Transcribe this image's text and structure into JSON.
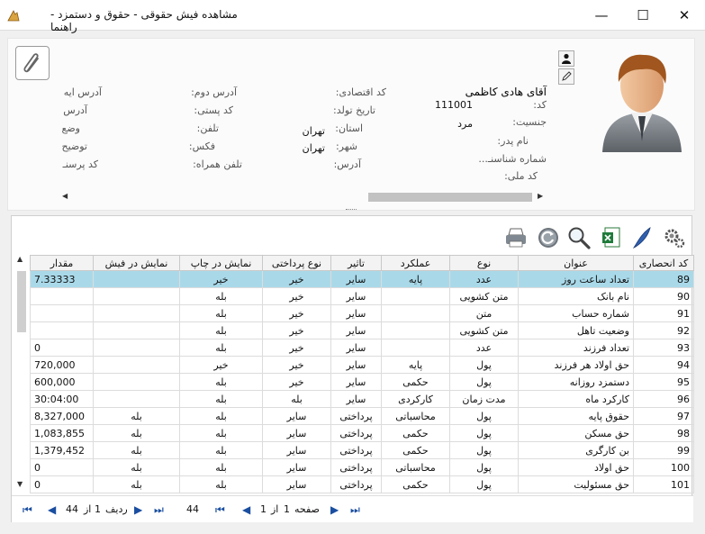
{
  "window": {
    "title": "مشاهده فیش حقوقی - حقوق و دستمزد - راهنما",
    "minimize_glyph": "—",
    "maximize_glyph": "☐",
    "close_glyph": "✕"
  },
  "employee": {
    "name": "آقای هادی کاظمی",
    "code_label": "کد:",
    "code_value": "111001",
    "gender_label": "جنسیت:",
    "gender_value": "مرد",
    "father_label": "نام پدر:",
    "id_number_label": "شماره شناسنـ...",
    "national_code_label": "کد ملی:",
    "economic_code_label": "کد اقتصادی:",
    "birth_date_label": "تاریخ تولد:",
    "province_label": "استان:",
    "province_value": "تهران",
    "city_label": "شهر:",
    "city_value": "تهران",
    "address_label": "آدرس:",
    "address2_label": "آدرس دوم:",
    "postal_code_label": "کد پستی:",
    "phone_label": "تلفن:",
    "fax_label": "فکس:",
    "mobile_label": "تلفن همراه:",
    "col4_address_label": "آدرس ایه",
    "col4_address_label2": "آدرس",
    "col4_status_label": "وضع",
    "col4_desc_label": "توضیح",
    "col4_personnel_code_label": "کد پرسنـ"
  },
  "grid": {
    "columns": [
      "کد انحصاری",
      "عنوان",
      "نوع",
      "عملکرد",
      "تاثیر",
      "نوع پرداختی",
      "نمایش در چاپ",
      "نمایش در فیش",
      "مقدار"
    ],
    "rows": [
      {
        "code": "89",
        "title": "تعداد ساعت روز",
        "type": "عدد",
        "perf": "پایه",
        "effect": "سایر",
        "pay": "خیر",
        "print": "خیر",
        "show": "",
        "amount": "7.33333",
        "selected": true
      },
      {
        "code": "90",
        "title": "نام بانک",
        "type": "متن کشویی",
        "perf": "",
        "effect": "سایر",
        "pay": "خیر",
        "print": "بله",
        "show": "",
        "amount": "",
        "selected": false
      },
      {
        "code": "91",
        "title": "شماره حساب",
        "type": "متن",
        "perf": "",
        "effect": "سایر",
        "pay": "خیر",
        "print": "بله",
        "show": "",
        "amount": "",
        "selected": false
      },
      {
        "code": "92",
        "title": "وضعیت تاهل",
        "type": "متن کشویی",
        "perf": "",
        "effect": "سایر",
        "pay": "خیر",
        "print": "بله",
        "show": "",
        "amount": "",
        "selected": false
      },
      {
        "code": "93",
        "title": "تعداد فرزند",
        "type": "عدد",
        "perf": "",
        "effect": "سایر",
        "pay": "خیر",
        "print": "بله",
        "show": "",
        "amount": "0",
        "selected": false
      },
      {
        "code": "94",
        "title": "حق اولاد هر فرزند",
        "type": "پول",
        "perf": "پایه",
        "effect": "سایر",
        "pay": "خیر",
        "print": "خیر",
        "show": "",
        "amount": "720,000",
        "selected": false
      },
      {
        "code": "95",
        "title": "دستمزد روزانه",
        "type": "پول",
        "perf": "حکمی",
        "effect": "سایر",
        "pay": "خیر",
        "print": "بله",
        "show": "",
        "amount": "600,000",
        "selected": false
      },
      {
        "code": "96",
        "title": "کارکرد ماه",
        "type": "مدت زمان",
        "perf": "کارکردی",
        "effect": "سایر",
        "pay": "بله",
        "print": "بله",
        "show": "",
        "amount": "30:04:00",
        "selected": false
      },
      {
        "code": "97",
        "title": "حقوق پایه",
        "type": "پول",
        "perf": "محاسباتی",
        "effect": "پرداختی",
        "pay": "سایر",
        "print": "بله",
        "show": "بله",
        "amount": "8,327,000",
        "selected": false
      },
      {
        "code": "98",
        "title": "حق مسکن",
        "type": "پول",
        "perf": "حکمی",
        "effect": "پرداختی",
        "pay": "سایر",
        "print": "بله",
        "show": "بله",
        "amount": "1,083,855",
        "selected": false
      },
      {
        "code": "99",
        "title": "بن کارگری",
        "type": "پول",
        "perf": "حکمی",
        "effect": "پرداختی",
        "pay": "سایر",
        "print": "بله",
        "show": "بله",
        "amount": "1,379,452",
        "selected": false
      },
      {
        "code": "100",
        "title": "حق اولاد",
        "type": "پول",
        "perf": "محاسباتی",
        "effect": "پرداختی",
        "pay": "سایر",
        "print": "بله",
        "show": "بله",
        "amount": "0",
        "selected": false
      },
      {
        "code": "101",
        "title": "حق مسئولیت",
        "type": "پول",
        "perf": "حکمی",
        "effect": "پرداختی",
        "pay": "سایر",
        "print": "بله",
        "show": "بله",
        "amount": "0",
        "selected": false
      }
    ]
  },
  "pager": {
    "row_label": "ردیف",
    "row_current": "1",
    "of_label": "از",
    "row_total": "44",
    "count": "44",
    "page_label": "صفحه",
    "page_current": "1",
    "page_total": "1"
  }
}
